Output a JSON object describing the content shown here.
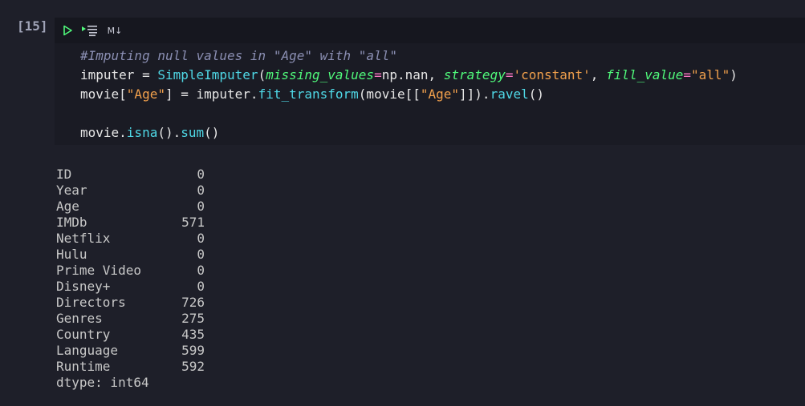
{
  "cell": {
    "execution_count": "[15]",
    "toolbar": {
      "run_icon": "play-icon",
      "run_by_line_icon": "run-by-line-icon",
      "markdown_label": "M↓"
    },
    "code_lines": [
      [
        {
          "t": "#Imputing null values in \"Age\" with \"all\"",
          "c": "c-comment"
        }
      ],
      [
        {
          "t": "imputer = ",
          "c": "c-plain"
        },
        {
          "t": "SimpleImputer",
          "c": "c-func"
        },
        {
          "t": "(",
          "c": "c-plain"
        },
        {
          "t": "missing_values",
          "c": "c-param"
        },
        {
          "t": "=",
          "c": "c-op"
        },
        {
          "t": "np.nan, ",
          "c": "c-plain"
        },
        {
          "t": "strategy",
          "c": "c-param"
        },
        {
          "t": "=",
          "c": "c-op"
        },
        {
          "t": "'constant'",
          "c": "c-str"
        },
        {
          "t": ", ",
          "c": "c-plain"
        },
        {
          "t": "fill_value",
          "c": "c-param"
        },
        {
          "t": "=",
          "c": "c-op"
        },
        {
          "t": "\"all\"",
          "c": "c-str"
        },
        {
          "t": ")",
          "c": "c-plain"
        }
      ],
      [
        {
          "t": "movie[",
          "c": "c-plain"
        },
        {
          "t": "\"Age\"",
          "c": "c-str"
        },
        {
          "t": "] = imputer.",
          "c": "c-plain"
        },
        {
          "t": "fit_transform",
          "c": "c-func"
        },
        {
          "t": "(movie[[",
          "c": "c-plain"
        },
        {
          "t": "\"Age\"",
          "c": "c-str"
        },
        {
          "t": "]]).",
          "c": "c-plain"
        },
        {
          "t": "ravel",
          "c": "c-func"
        },
        {
          "t": "()",
          "c": "c-plain"
        }
      ],
      [],
      [
        {
          "t": "movie.",
          "c": "c-plain"
        },
        {
          "t": "isna",
          "c": "c-func"
        },
        {
          "t": "().",
          "c": "c-plain"
        },
        {
          "t": "sum",
          "c": "c-func"
        },
        {
          "t": "()",
          "c": "c-plain"
        }
      ]
    ]
  },
  "output": {
    "rows": [
      {
        "label": "ID",
        "value": "0"
      },
      {
        "label": "Year",
        "value": "0"
      },
      {
        "label": "Age",
        "value": "0"
      },
      {
        "label": "IMDb",
        "value": "571"
      },
      {
        "label": "Netflix",
        "value": "0"
      },
      {
        "label": "Hulu",
        "value": "0"
      },
      {
        "label": "Prime Video",
        "value": "0"
      },
      {
        "label": "Disney+",
        "value": "0"
      },
      {
        "label": "Directors",
        "value": "726"
      },
      {
        "label": "Genres",
        "value": "275"
      },
      {
        "label": "Country",
        "value": "435"
      },
      {
        "label": "Language",
        "value": "599"
      },
      {
        "label": "Runtime",
        "value": "592"
      }
    ],
    "dtype": "dtype: int64"
  },
  "colors": {
    "background": "#1e1f29",
    "cell_background": "#1a1b24",
    "run_icon": "#50fa7b"
  }
}
